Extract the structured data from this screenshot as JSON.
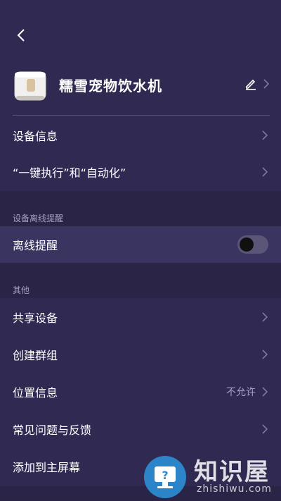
{
  "header": {
    "back_icon": "chevron-left-icon",
    "device_name": "糯雪宠物饮水机",
    "edit_icon": "pencil-icon"
  },
  "top_items": [
    {
      "label": "设备信息"
    },
    {
      "label": "“一键执行”和“自动化”"
    }
  ],
  "offline_section": {
    "title": "设备离线提醒",
    "item_label": "离线提醒",
    "toggle_on": false
  },
  "other_section": {
    "title": "其他",
    "items": [
      {
        "label": "共享设备",
        "value": ""
      },
      {
        "label": "创建群组",
        "value": ""
      },
      {
        "label": "位置信息",
        "value": "不允许"
      },
      {
        "label": "常见问题与反馈",
        "value": ""
      },
      {
        "label": "添加到主屏幕",
        "value": ""
      }
    ]
  },
  "watermark": {
    "text": "知识屋",
    "subtext": "zhishiwu.com"
  },
  "colors": {
    "background": "#302a52",
    "section_background": "#2a2447",
    "accent_watermark": "#2c8fd6"
  }
}
